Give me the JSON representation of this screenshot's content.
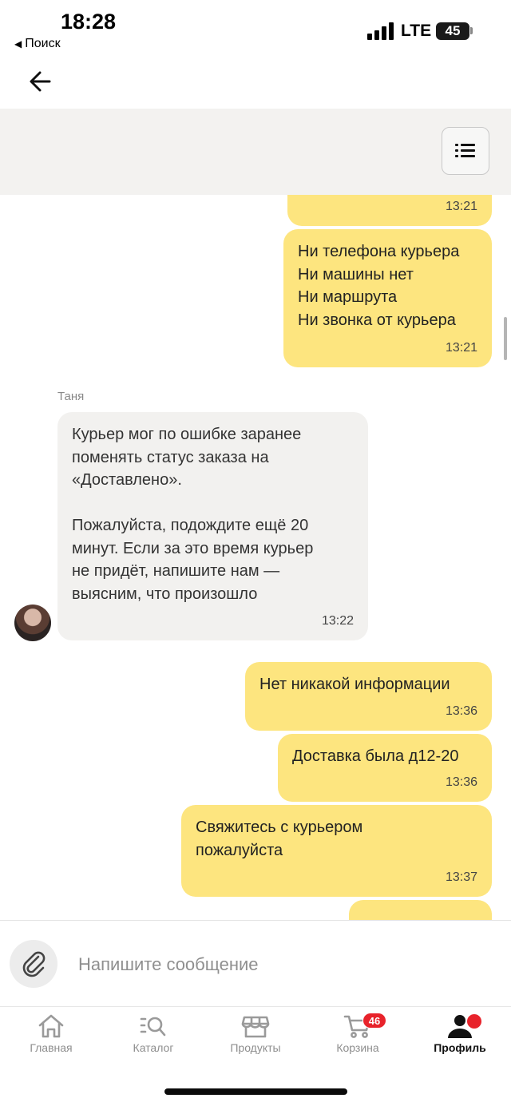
{
  "status_bar": {
    "time": "18:28",
    "back_app": "Поиск",
    "network": "LTE",
    "battery": "45"
  },
  "chat": {
    "sender_name": "Таня",
    "messages": [
      {
        "direction": "out",
        "lines": [],
        "time": "13:21"
      },
      {
        "direction": "out",
        "lines": [
          "Ни телефона курьера",
          "Ни машины нет",
          "Ни маршрута",
          "Ни звонка от курьера"
        ],
        "time": "13:21"
      },
      {
        "direction": "in",
        "sender": "Таня",
        "lines": [
          "Курьер мог по ошибке заранее",
          "поменять статус заказа на",
          "«Доставлено».",
          "",
          "Пожалуйста, подождите ещё 20",
          "минут. Если за это время курьер",
          "не придёт, напишите нам —",
          "выясним, что произошло"
        ],
        "time": "13:22"
      },
      {
        "direction": "out",
        "lines": [
          "Нет никакой информации"
        ],
        "time": "13:36"
      },
      {
        "direction": "out",
        "lines": [
          "Доставка была д12-20"
        ],
        "time": "13:36"
      },
      {
        "direction": "out",
        "lines": [
          "Свяжитесь с курьером",
          "пожалуйста"
        ],
        "time": "13:37"
      }
    ]
  },
  "composer": {
    "placeholder": "Напишите сообщение",
    "value": ""
  },
  "tabbar": {
    "items": [
      {
        "label": "Главная",
        "icon": "home-icon"
      },
      {
        "label": "Каталог",
        "icon": "catalog-search-icon"
      },
      {
        "label": "Продукты",
        "icon": "store-icon"
      },
      {
        "label": "Корзина",
        "icon": "cart-icon",
        "badge": "46"
      },
      {
        "label": "Профиль",
        "icon": "profile-icon",
        "active": true
      }
    ]
  },
  "colors": {
    "outgoing_bubble": "#fde57f",
    "incoming_bubble": "#f2f1ef",
    "header_background": "#f3f2f0",
    "badge": "#e8232b"
  }
}
